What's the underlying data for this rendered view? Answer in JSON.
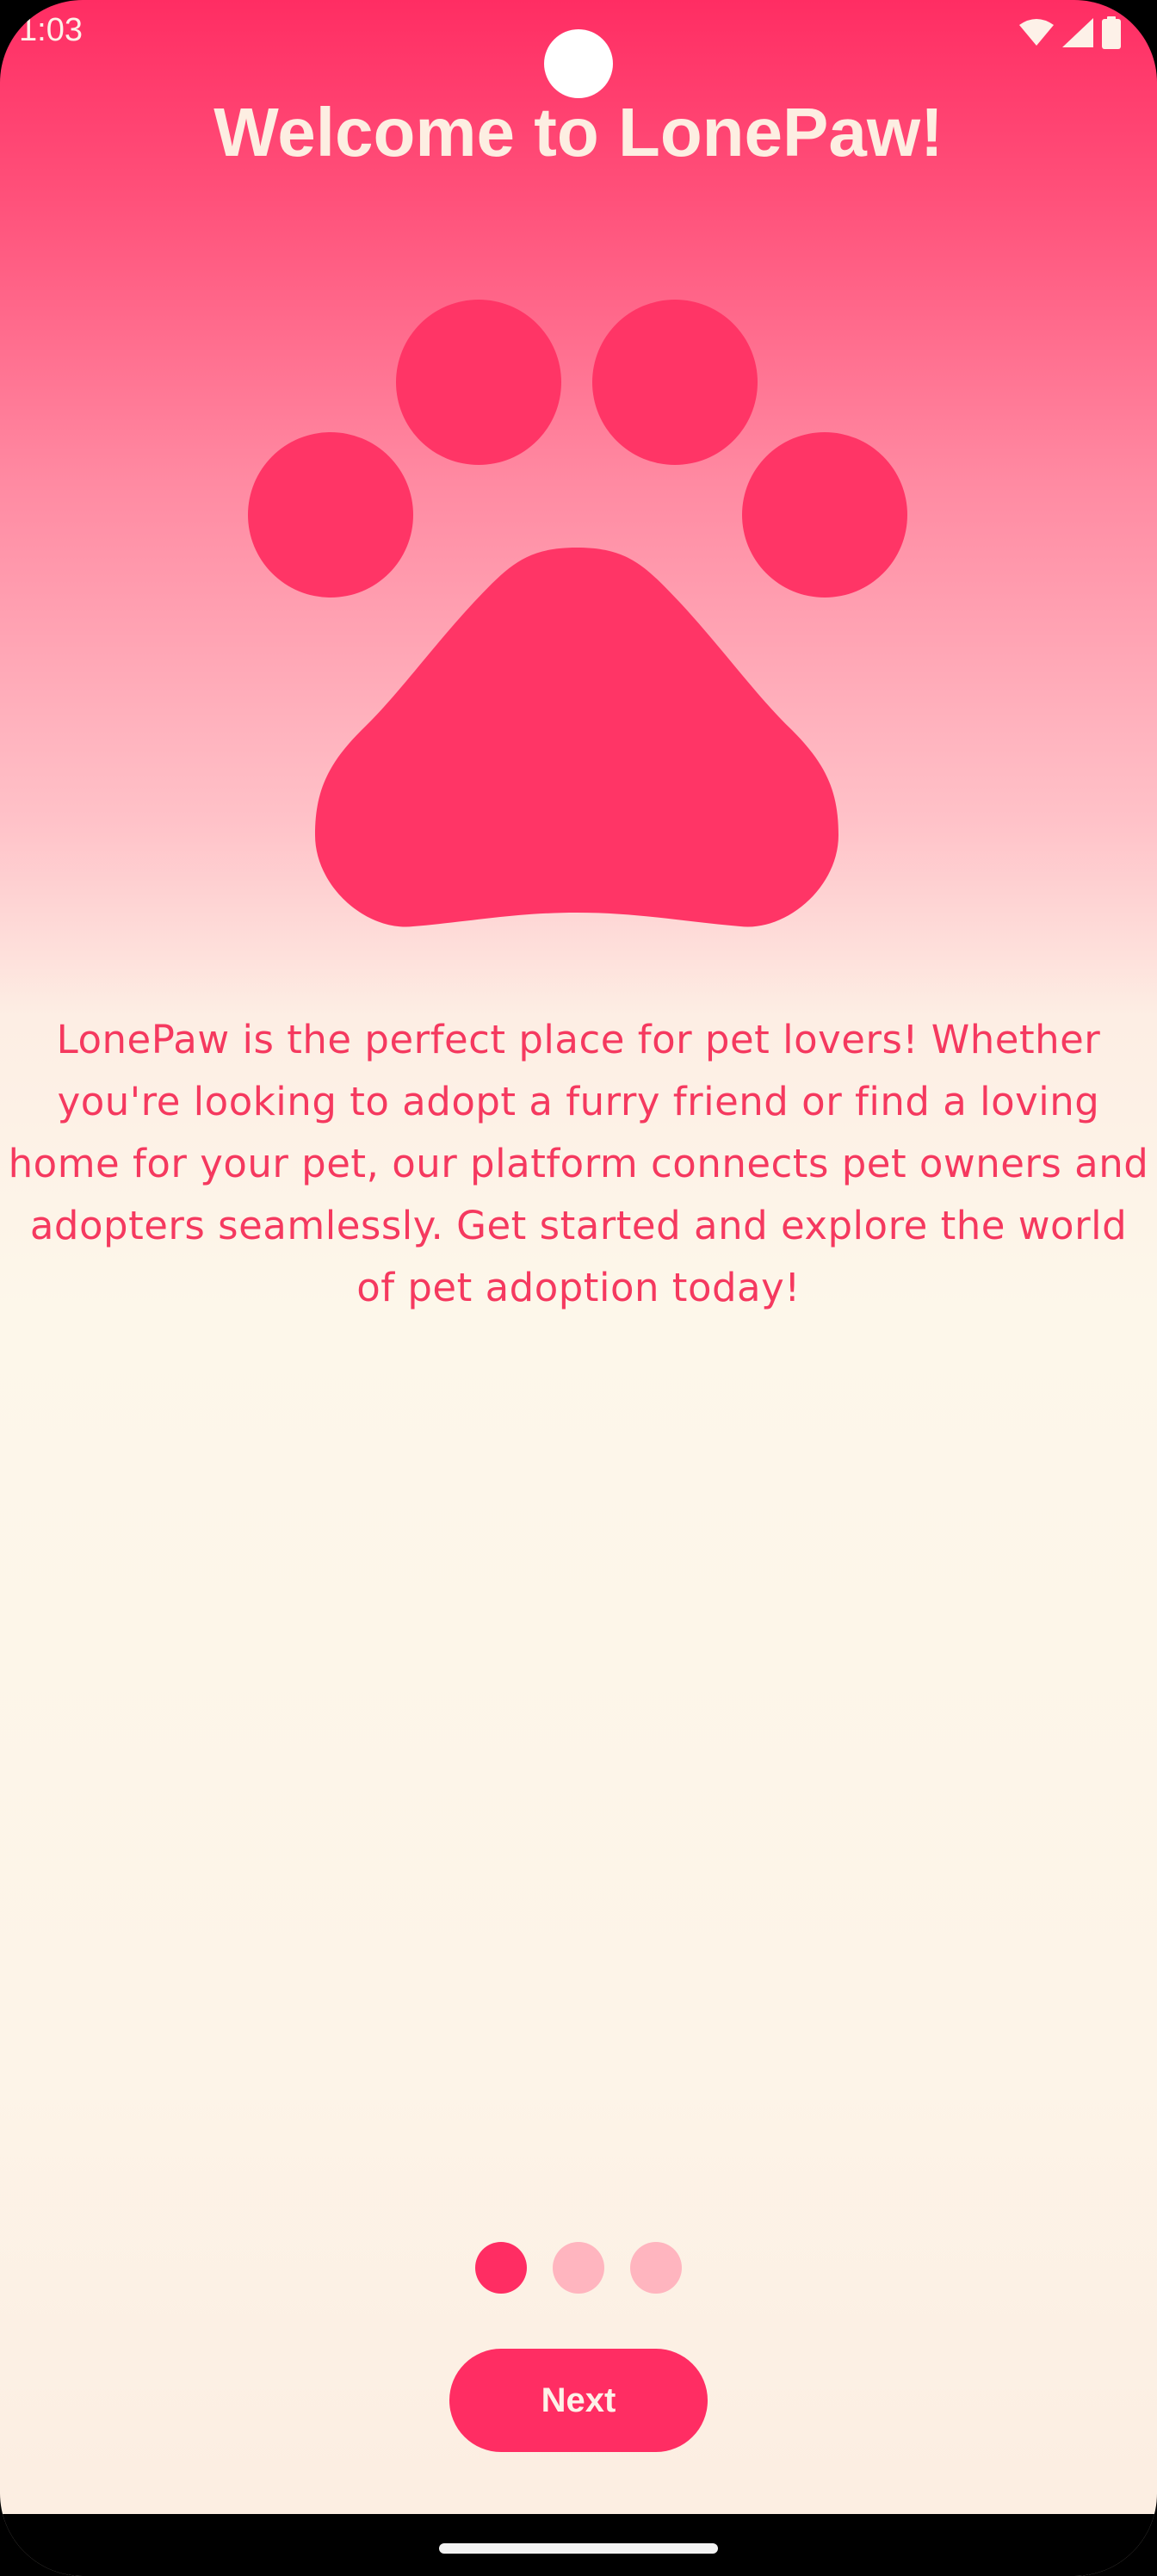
{
  "status_bar": {
    "time": "1:03",
    "icons": [
      "wifi-icon",
      "cellular-signal-icon",
      "battery-icon"
    ]
  },
  "onboarding": {
    "title": "Welcome to LonePaw!",
    "illustration_icon": "paw-print-icon",
    "description": "LonePaw is the perfect place for pet lovers! Whether you're looking to adopt a furry friend or find a loving home for your pet, our platform connects pet owners and adopters seamlessly. Get started and explore the world of pet adoption today!",
    "page_indicator": {
      "total_pages": 3,
      "current_page": 1
    },
    "next_label": "Next"
  },
  "colors": {
    "primary": "#ff2d63",
    "title_text": "#fdeee2",
    "description_text": "#f5395f",
    "dot_inactive": "#ffb5bf",
    "background_light": "#fdf4e8"
  }
}
